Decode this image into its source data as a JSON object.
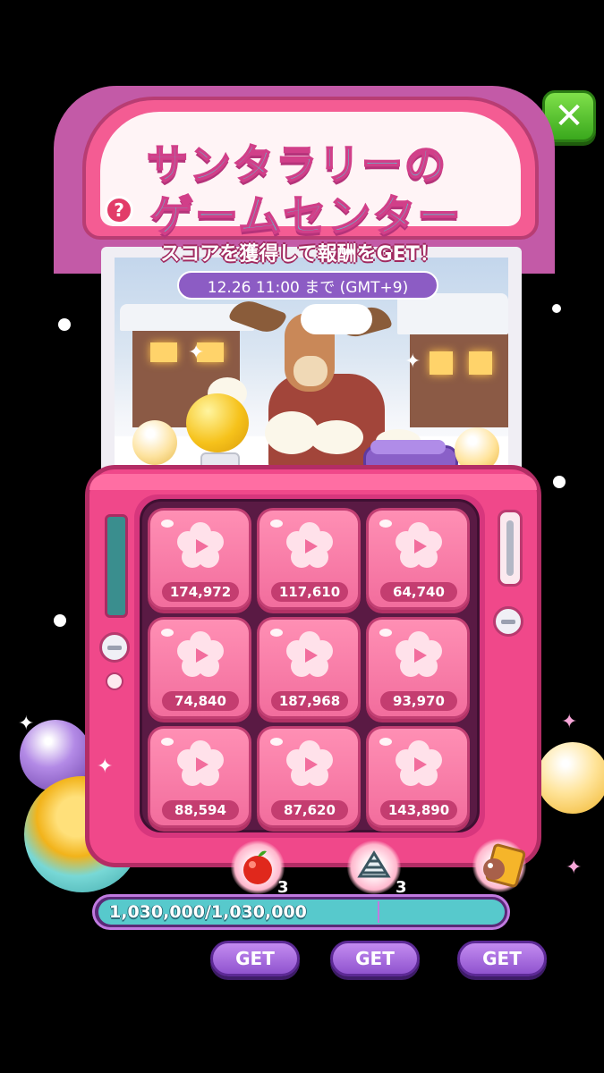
{
  "header": {
    "title_line1": "サンタラリーの",
    "title_line2": "ゲームセンター",
    "help_label": "?",
    "subtitle": "スコアを獲得して報酬をGET！",
    "deadline": "12.26 11:00 まで (GMT+9)",
    "close_label": "✕"
  },
  "grid": {
    "tiles": [
      {
        "score": "174,972"
      },
      {
        "score": "117,610"
      },
      {
        "score": "64,740"
      },
      {
        "score": "74,840"
      },
      {
        "score": "187,968"
      },
      {
        "score": "93,970"
      },
      {
        "score": "88,594"
      },
      {
        "score": "87,620"
      },
      {
        "score": "143,890"
      }
    ]
  },
  "rewards": [
    {
      "icon": "apple-icon",
      "count": "3"
    },
    {
      "icon": "striped-candy-icon",
      "count": "3"
    },
    {
      "icon": "character-card-icon",
      "count": ""
    }
  ],
  "progress": {
    "text": "1,030,000/1,030,000",
    "value": 1.0
  },
  "buttons": {
    "get_1": "GET",
    "get_2": "GET",
    "get_3": "GET"
  },
  "colors": {
    "machine_pink": "#f0488a",
    "tile_pink": "#ff8fb4",
    "title_cyan": "#4ed0d6",
    "progress_cyan": "#57c9cc",
    "get_purple": "#9054cf",
    "close_green": "#3aa81d"
  }
}
